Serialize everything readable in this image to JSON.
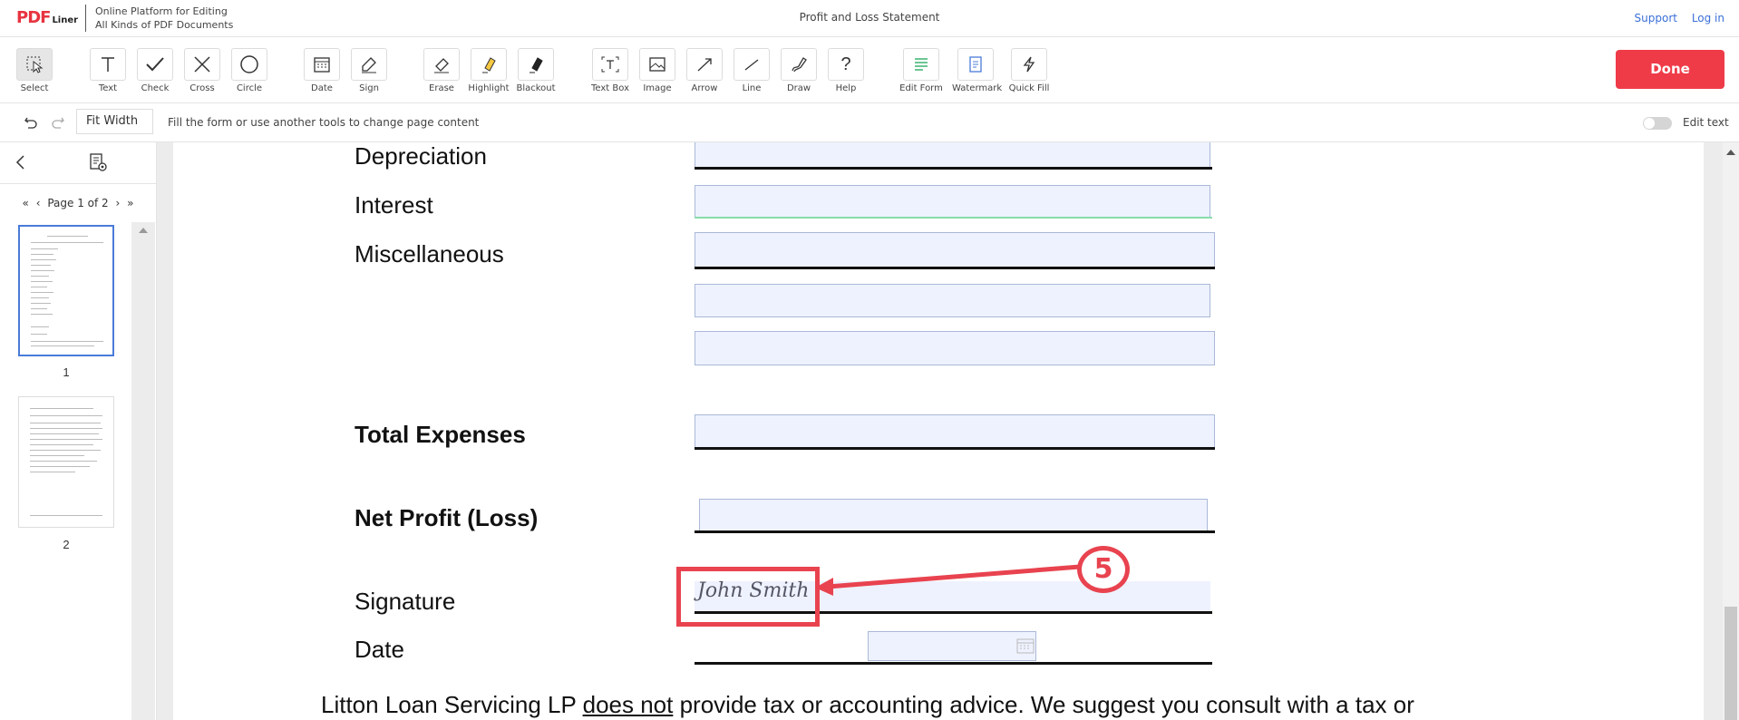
{
  "app": {
    "logo_main": "PDF",
    "logo_sub": "Liner",
    "tagline_line1": "Online Platform for Editing",
    "tagline_line2": "All Kinds of PDF Documents",
    "doc_title": "Profit and Loss Statement",
    "support_label": "Support",
    "login_label": "Log in"
  },
  "toolbar": {
    "tools": [
      {
        "label": "Select",
        "icon": "select-cursor-icon"
      },
      {
        "label": "Text",
        "icon": "text-icon"
      },
      {
        "label": "Check",
        "icon": "check-icon"
      },
      {
        "label": "Cross",
        "icon": "cross-icon"
      },
      {
        "label": "Circle",
        "icon": "circle-icon"
      },
      {
        "label": "Date",
        "icon": "calendar-icon"
      },
      {
        "label": "Sign",
        "icon": "pen-icon"
      },
      {
        "label": "Erase",
        "icon": "eraser-icon"
      },
      {
        "label": "Highlight",
        "icon": "highlighter-icon"
      },
      {
        "label": "Blackout",
        "icon": "blackout-icon"
      },
      {
        "label": "Text Box",
        "icon": "textbox-icon"
      },
      {
        "label": "Image",
        "icon": "image-icon"
      },
      {
        "label": "Arrow",
        "icon": "arrow-icon"
      },
      {
        "label": "Line",
        "icon": "line-icon"
      },
      {
        "label": "Draw",
        "icon": "draw-icon"
      },
      {
        "label": "Help",
        "icon": "help-icon"
      },
      {
        "label": "Edit Form",
        "icon": "edit-form-icon"
      },
      {
        "label": "Watermark",
        "icon": "watermark-icon"
      },
      {
        "label": "Quick Fill",
        "icon": "lightning-icon"
      }
    ],
    "done_label": "Done"
  },
  "subbar": {
    "zoom_value": "Fit Width",
    "hint": "Fill the form or use another tools to change page content",
    "edit_text_label": "Edit text"
  },
  "sidebar": {
    "pager_text": "Page 1 of 2",
    "thumbs": [
      {
        "num": "1"
      },
      {
        "num": "2"
      }
    ]
  },
  "document": {
    "labels": {
      "depreciation": "Depreciation",
      "interest": "Interest",
      "miscellaneous": "Miscellaneous",
      "total_expenses": "Total Expenses",
      "net_profit": "Net Profit (Loss)",
      "signature": "Signature",
      "date": "Date"
    },
    "signature_value": "John Smith",
    "disclaimer_a": "Litton Loan Servicing LP ",
    "disclaimer_u": "does not",
    "disclaimer_b": " provide tax or accounting advice.  We suggest you consult with a tax or"
  },
  "annotation": {
    "step_number": "5",
    "color": "#e8434f"
  }
}
